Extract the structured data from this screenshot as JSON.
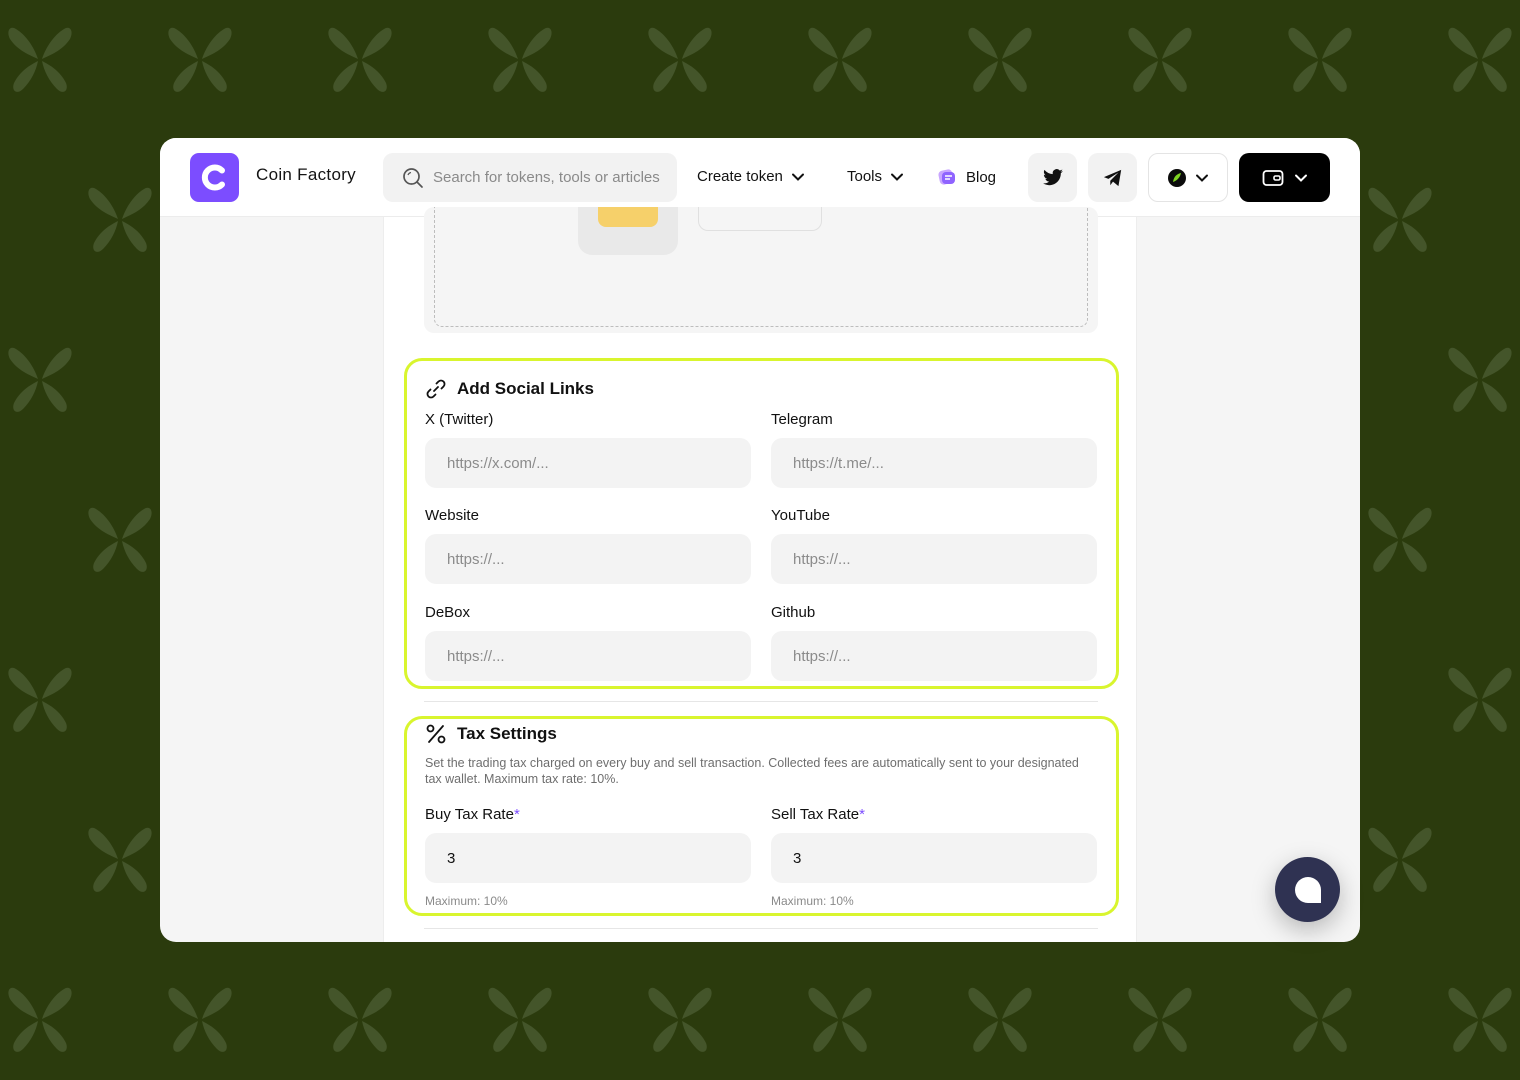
{
  "brand": {
    "name": "Coin Factory"
  },
  "search": {
    "placeholder": "Search for tokens, tools or articles"
  },
  "nav": {
    "create_token": "Create token",
    "tools": "Tools",
    "blog": "Blog"
  },
  "social": {
    "title": "Add Social Links",
    "fields": [
      {
        "label": "X (Twitter)",
        "placeholder": "https://x.com/..."
      },
      {
        "label": "Telegram",
        "placeholder": "https://t.me/..."
      },
      {
        "label": "Website",
        "placeholder": "https://..."
      },
      {
        "label": "YouTube",
        "placeholder": "https://..."
      },
      {
        "label": "DeBox",
        "placeholder": "https://..."
      },
      {
        "label": "Github",
        "placeholder": "https://..."
      }
    ]
  },
  "tax": {
    "title": "Tax Settings",
    "description": "Set the trading tax charged on every buy and sell transaction. Collected fees are automatically sent to your designated tax wallet. Maximum tax rate: 10%.",
    "buy": {
      "label": "Buy Tax Rate",
      "value": "3",
      "hint": "Maximum: 10%"
    },
    "sell": {
      "label": "Sell Tax Rate",
      "value": "3",
      "hint": "Maximum: 10%"
    },
    "required_mark": "*"
  },
  "colors": {
    "background": "#2b3b0d",
    "accent": "#7c4dff",
    "highlight": "#d9f52e",
    "chat": "#2f3252"
  }
}
